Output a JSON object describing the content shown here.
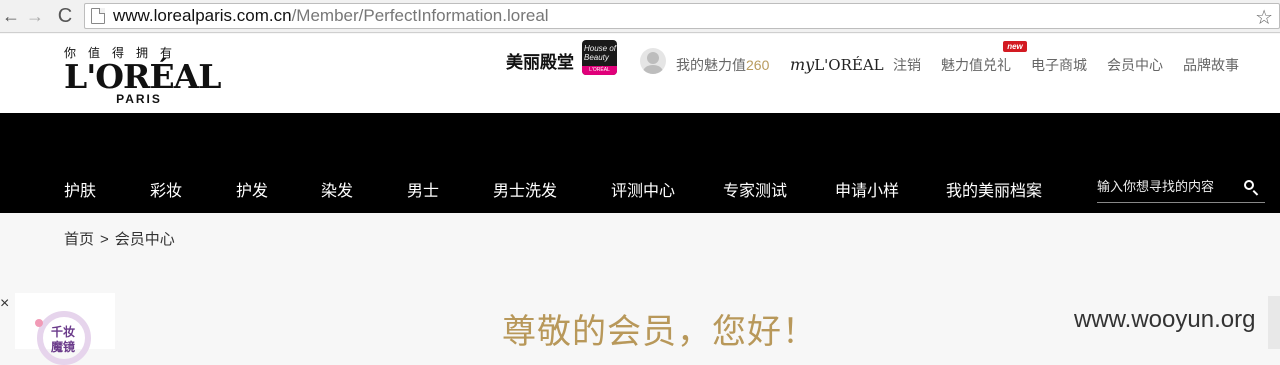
{
  "browser": {
    "url_host": "www.lorealparis.com.cn",
    "url_path": "/Member/PerfectInformation.loreal",
    "back_glyph": "←",
    "forward_glyph": "→",
    "reload_glyph": "C",
    "star_glyph": "☆"
  },
  "header": {
    "logo_slogan": "你值得拥有",
    "logo_brand": "L'ORÉAL",
    "logo_sub": "PARIS",
    "hob_label": "美丽殿堂",
    "hob_badge_text": "House of Beauty",
    "hob_badge_bar": "L'ORÉAL",
    "charm_label": "我的魅力值",
    "charm_value": "260",
    "myloreal_prefix": "my",
    "myloreal_brand": "L'ORÉAL",
    "new_badge": "new",
    "links": [
      "注销",
      "魅力值兑礼",
      "电子商城",
      "会员中心",
      "品牌故事"
    ]
  },
  "nav": {
    "items": [
      "护肤",
      "彩妆",
      "护发",
      "染发",
      "男士",
      "男士洗发",
      "评测中心",
      "专家测试",
      "申请小样",
      "我的美丽档案"
    ],
    "search_placeholder": "输入你想寻找的内容"
  },
  "breadcrumb": {
    "home": "首页",
    "separator": ">",
    "current": "会员中心"
  },
  "main": {
    "welcome": "尊敬的会员，您好！"
  },
  "float_ad": {
    "close_glyph": "×",
    "line1": "千妆",
    "line2": "魔镜"
  },
  "watermark": "www.wooyun.org"
}
